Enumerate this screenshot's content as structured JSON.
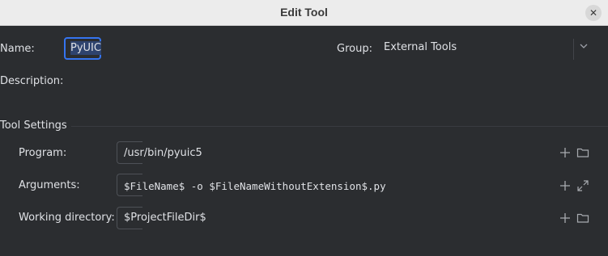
{
  "window": {
    "title": "Edit Tool"
  },
  "name": {
    "label": "Name:",
    "value": "PyUIC"
  },
  "group": {
    "label": "Group:",
    "value": "External Tools"
  },
  "description": {
    "label": "Description:"
  },
  "tool_settings": {
    "heading": "Tool Settings",
    "program": {
      "label": "Program:",
      "value": "/usr/bin/pyuic5"
    },
    "arguments": {
      "label": "Arguments:",
      "value": "$FileName$ -o  $FileNameWithoutExtension$.py"
    },
    "working_directory": {
      "label": "Working directory:",
      "value": "$ProjectFileDir$"
    }
  },
  "icons": {
    "close": "close-icon",
    "add": "plus-icon",
    "folder": "folder-icon",
    "expand": "expand-icon",
    "chevron": "chevron-down-icon"
  },
  "colors": {
    "background": "#2b2d30",
    "titlebar": "#ececec",
    "focus": "#3574f0",
    "text": "#dfe1e5"
  }
}
